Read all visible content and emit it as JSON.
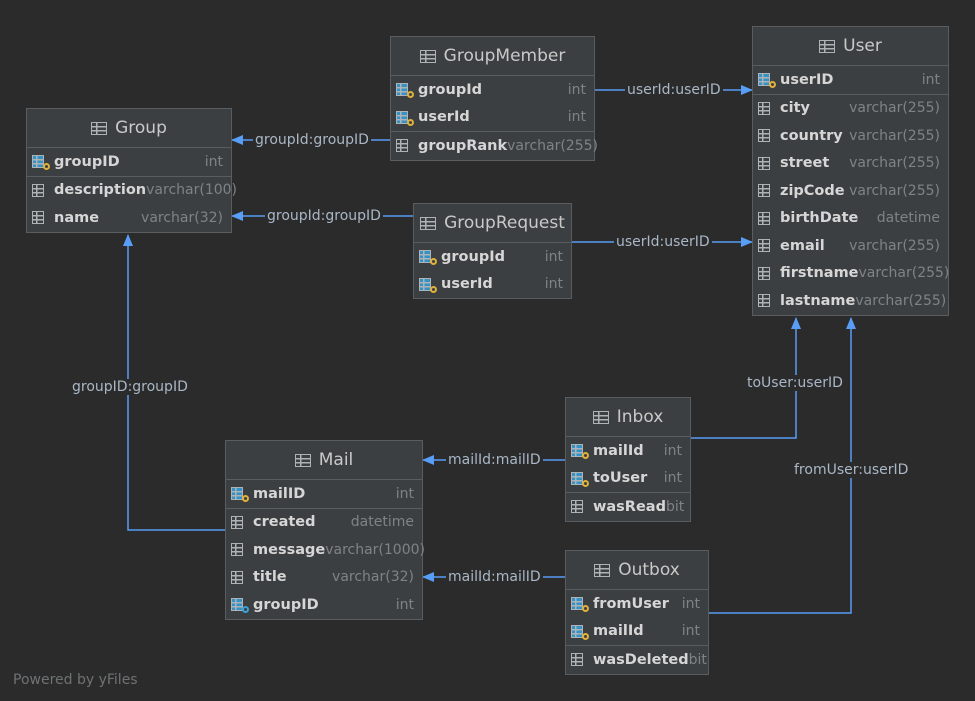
{
  "tables": {
    "group": {
      "name": "Group",
      "fields": [
        {
          "name": "groupID",
          "type": "int",
          "kind": "pk"
        },
        {
          "name": "description",
          "type": "varchar(100)",
          "kind": "col"
        },
        {
          "name": "name",
          "type": "varchar(32)",
          "kind": "col"
        }
      ]
    },
    "groupmember": {
      "name": "GroupMember",
      "fields": [
        {
          "name": "groupId",
          "type": "int",
          "kind": "pk"
        },
        {
          "name": "userId",
          "type": "int",
          "kind": "pk"
        },
        {
          "name": "groupRank",
          "type": "varchar(255)",
          "kind": "col"
        }
      ]
    },
    "user": {
      "name": "User",
      "fields": [
        {
          "name": "userID",
          "type": "int",
          "kind": "pk"
        },
        {
          "name": "city",
          "type": "varchar(255)",
          "kind": "col"
        },
        {
          "name": "country",
          "type": "varchar(255)",
          "kind": "col"
        },
        {
          "name": "street",
          "type": "varchar(255)",
          "kind": "col"
        },
        {
          "name": "zipCode",
          "type": "varchar(255)",
          "kind": "col"
        },
        {
          "name": "birthDate",
          "type": "datetime",
          "kind": "col"
        },
        {
          "name": "email",
          "type": "varchar(255)",
          "kind": "col"
        },
        {
          "name": "firstname",
          "type": "varchar(255)",
          "kind": "col"
        },
        {
          "name": "lastname",
          "type": "varchar(255)",
          "kind": "col"
        }
      ]
    },
    "grouprequest": {
      "name": "GroupRequest",
      "fields": [
        {
          "name": "groupId",
          "type": "int",
          "kind": "pk"
        },
        {
          "name": "userId",
          "type": "int",
          "kind": "pk"
        }
      ]
    },
    "inbox": {
      "name": "Inbox",
      "fields": [
        {
          "name": "mailId",
          "type": "int",
          "kind": "pk"
        },
        {
          "name": "toUser",
          "type": "int",
          "kind": "pk"
        },
        {
          "name": "wasRead",
          "type": "bit",
          "kind": "col"
        }
      ]
    },
    "mail": {
      "name": "Mail",
      "fields": [
        {
          "name": "mailID",
          "type": "int",
          "kind": "pk"
        },
        {
          "name": "created",
          "type": "datetime",
          "kind": "col"
        },
        {
          "name": "message",
          "type": "varchar(1000)",
          "kind": "col"
        },
        {
          "name": "title",
          "type": "varchar(32)",
          "kind": "col"
        },
        {
          "name": "groupID",
          "type": "int",
          "kind": "fk"
        }
      ]
    },
    "outbox": {
      "name": "Outbox",
      "fields": [
        {
          "name": "fromUser",
          "type": "int",
          "kind": "pk"
        },
        {
          "name": "mailId",
          "type": "int",
          "kind": "pk"
        },
        {
          "name": "wasDeleted",
          "type": "bit",
          "kind": "col"
        }
      ]
    }
  },
  "edge_labels": {
    "gm_user": "userId:userID",
    "gm_group": "groupId:groupID",
    "gr_group": "groupId:groupID",
    "gr_user": "userId:userID",
    "mail_group": "groupID:groupID",
    "inbox_user": "toUser:userID",
    "outbox_user": "fromUser:userID",
    "inbox_mail": "mailId:mailID",
    "outbox_mail": "mailId:mailID"
  },
  "footer": "Powered by yFiles",
  "colors": {
    "background": "#2b2b2b",
    "table": "#3c3f41",
    "edge": "#589df6",
    "pk_key": "#e0b13b",
    "fk_key": "#3aa3d8"
  }
}
